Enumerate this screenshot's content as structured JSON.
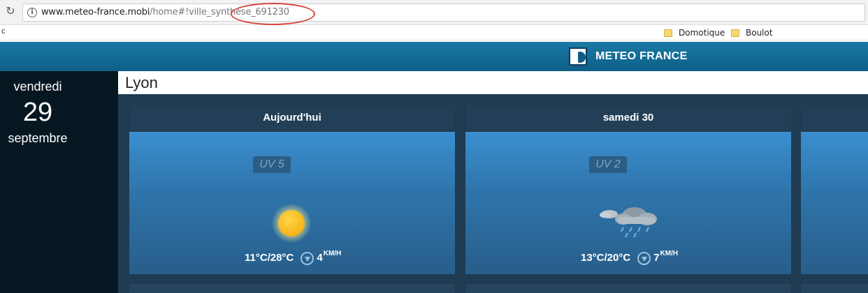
{
  "browser": {
    "url_domain": "www.meteo-france.mobi",
    "url_path": "/home#!ville_synthese_691230",
    "bookmarks_edge": "c",
    "bookmarks": [
      {
        "label": "Domotique",
        "icon": "folder-icon"
      },
      {
        "label": "Boulot",
        "icon": "folder-icon"
      }
    ],
    "reload_icon": "↻",
    "info_icon": "i"
  },
  "site": {
    "brand": "METEO FRANCE",
    "header_color": "#1a7aa5"
  },
  "date_panel": {
    "weekday": "vendredi",
    "day": "29",
    "month": "septembre"
  },
  "city": "Lyon",
  "forecast": [
    {
      "title": "Aujourd'hui",
      "uv": "UV 5",
      "icon": "sun-icon",
      "temps": "11°C/28°C",
      "wind_speed": "4",
      "wind_unit": "KM/H"
    },
    {
      "title": "samedi 30",
      "uv": "UV 2",
      "icon": "rain-cloud-icon",
      "temps": "13°C/20°C",
      "wind_speed": "7",
      "wind_unit": "KM/H"
    }
  ]
}
